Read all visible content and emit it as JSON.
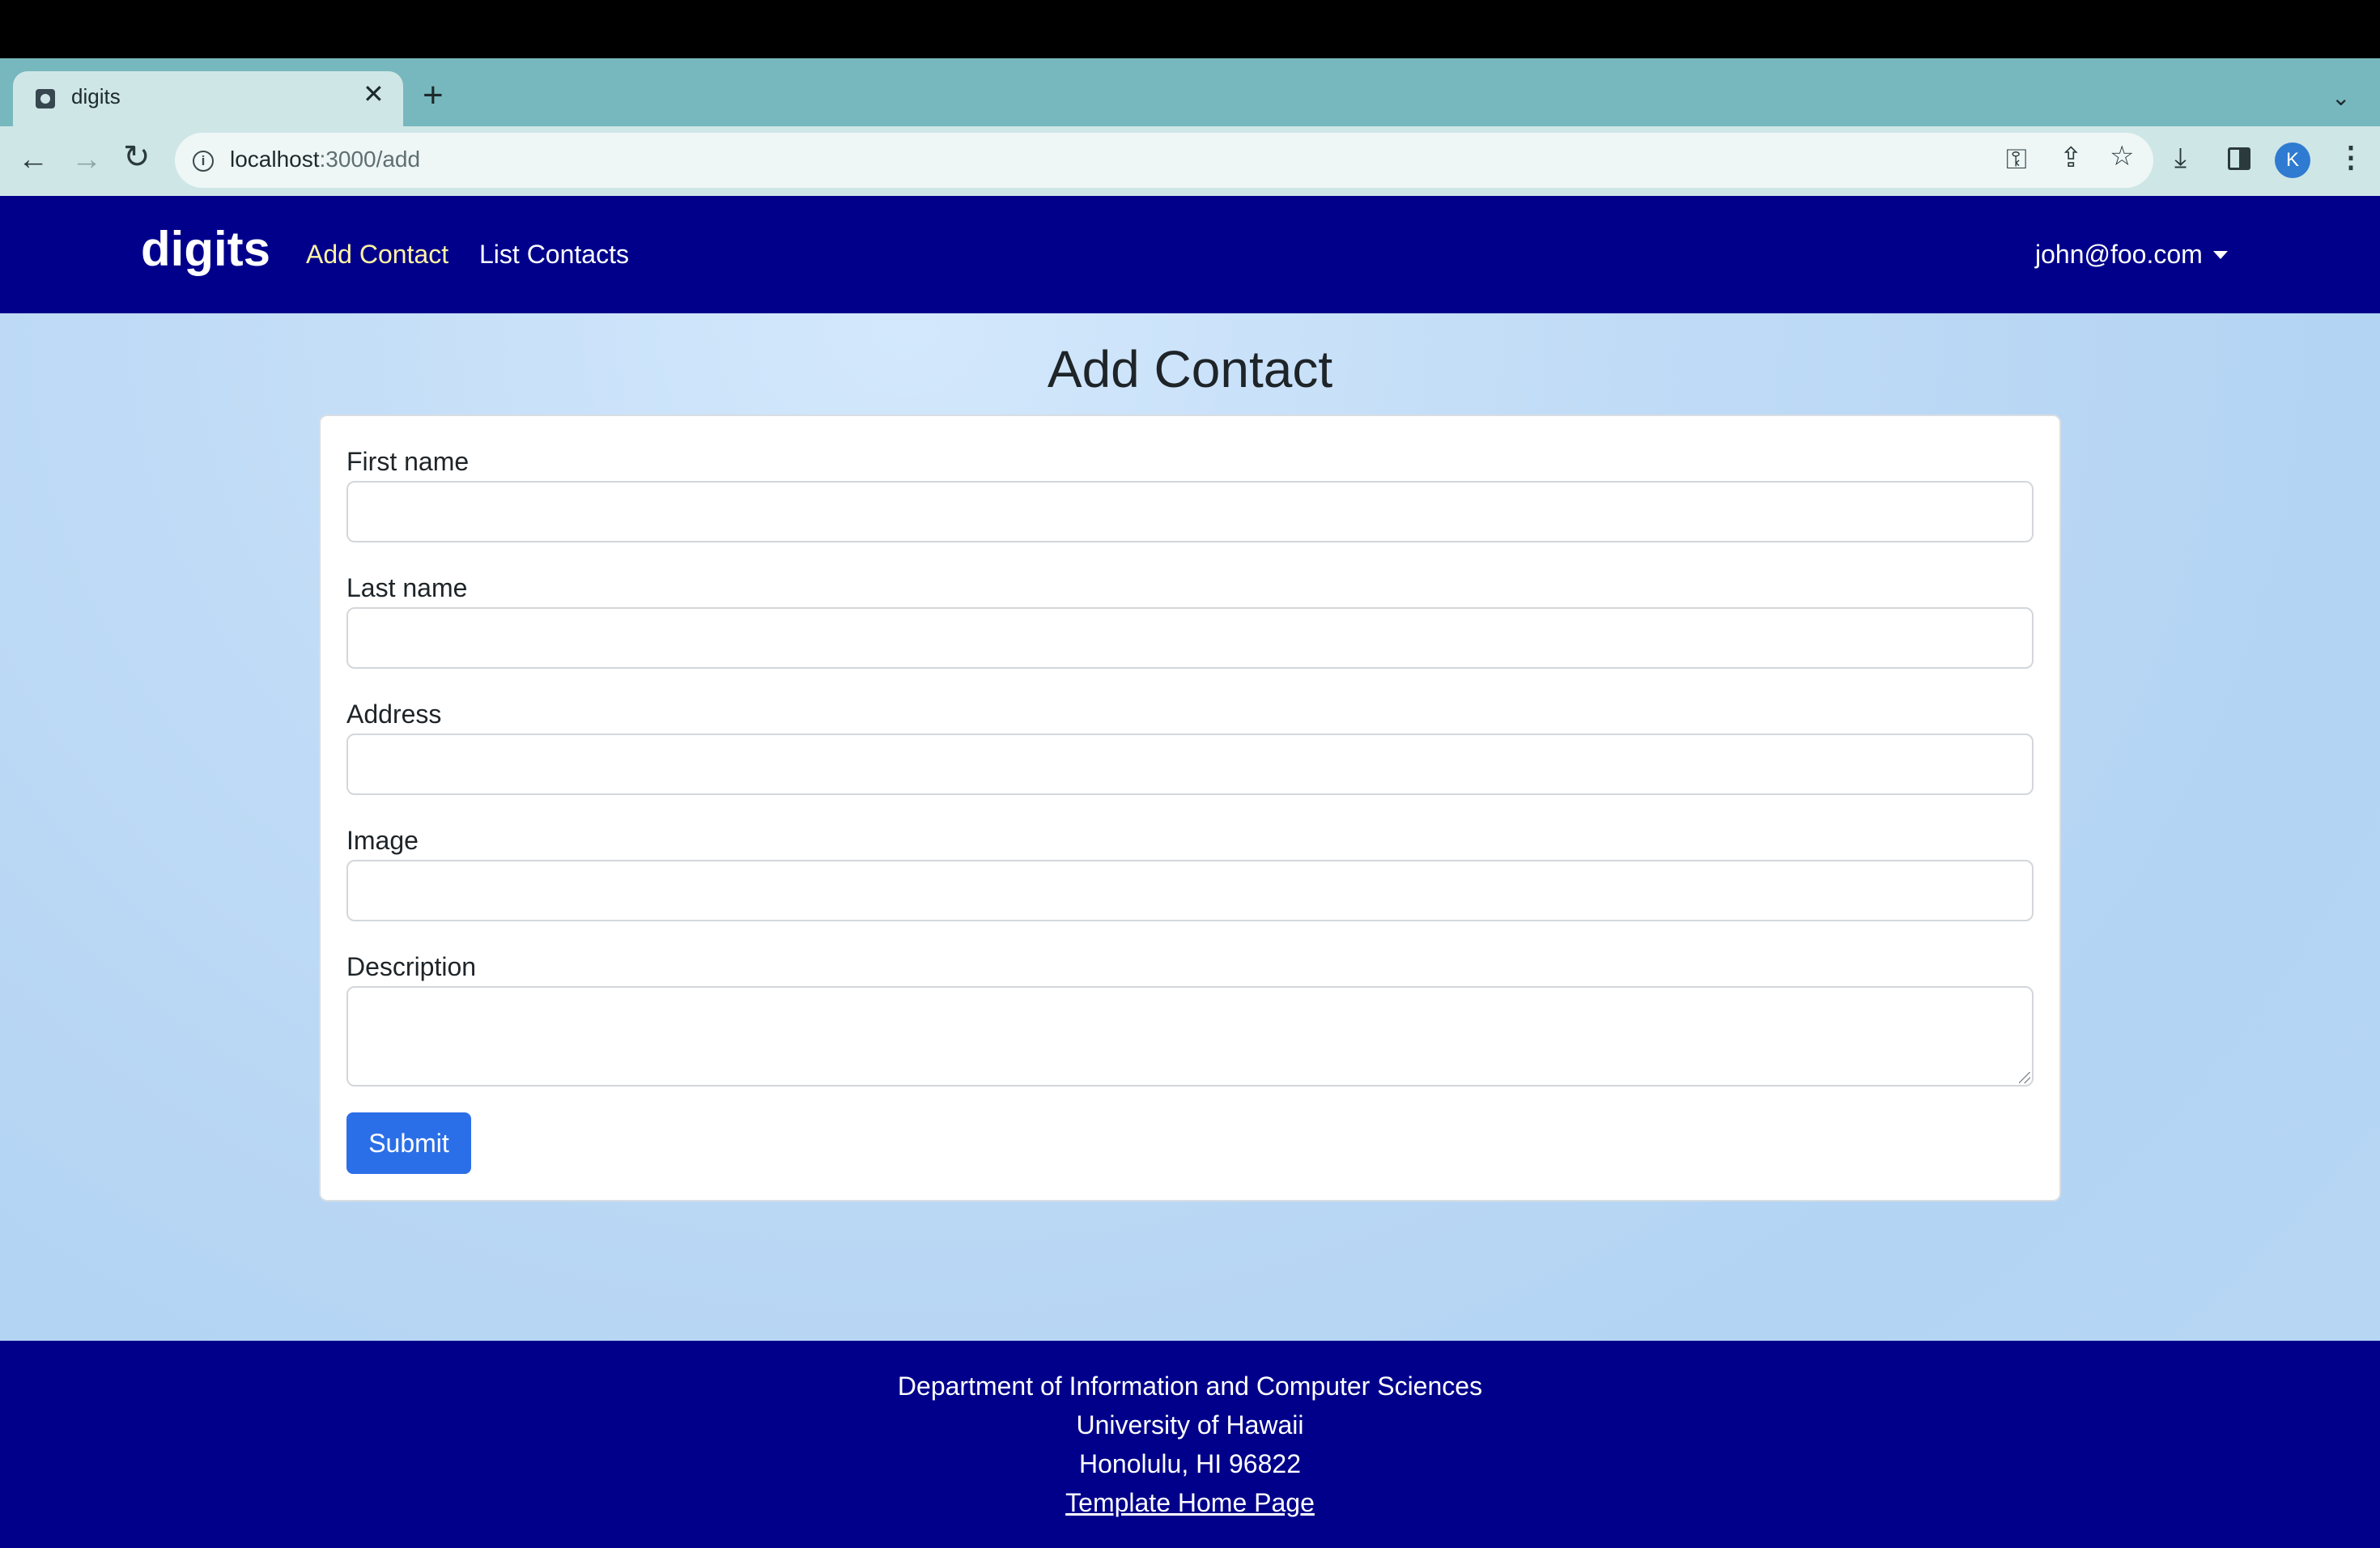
{
  "browser": {
    "tab_title": "digits",
    "tab_close": "✕",
    "new_tab": "+",
    "tab_list": "⌄",
    "url_host": "localhost",
    "url_path": ":3000/add",
    "icons": [
      "back-arrow-icon",
      "forward-arrow-icon",
      "reload-icon",
      "info-icon",
      "key-icon",
      "share-icon",
      "star-icon",
      "download-icon",
      "side-panel-icon",
      "profile-avatar",
      "kebab-menu-icon"
    ],
    "profile_initial": "K"
  },
  "navbar": {
    "brand": "digits",
    "links": [
      {
        "label": "Add Contact",
        "active": true
      },
      {
        "label": "List Contacts",
        "active": false
      }
    ],
    "user": "john@foo.com",
    "background": "#00008b",
    "active_color": "#fff3a3"
  },
  "page": {
    "title": "Add Contact"
  },
  "form": {
    "fields": [
      {
        "label": "First name",
        "value": "",
        "placeholder": ""
      },
      {
        "label": "Last name",
        "value": "",
        "placeholder": ""
      },
      {
        "label": "Address",
        "value": "",
        "placeholder": ""
      },
      {
        "label": "Image",
        "value": "",
        "placeholder": ""
      },
      {
        "label": "Description",
        "value": "",
        "placeholder": ""
      }
    ],
    "submit_label": "Submit",
    "submit_color": "#2b6fe8"
  },
  "footer": {
    "lines": [
      "Department of Information and Computer Sciences",
      "University of Hawaii",
      "Honolulu, HI 96822"
    ],
    "link": "Template Home Page"
  }
}
